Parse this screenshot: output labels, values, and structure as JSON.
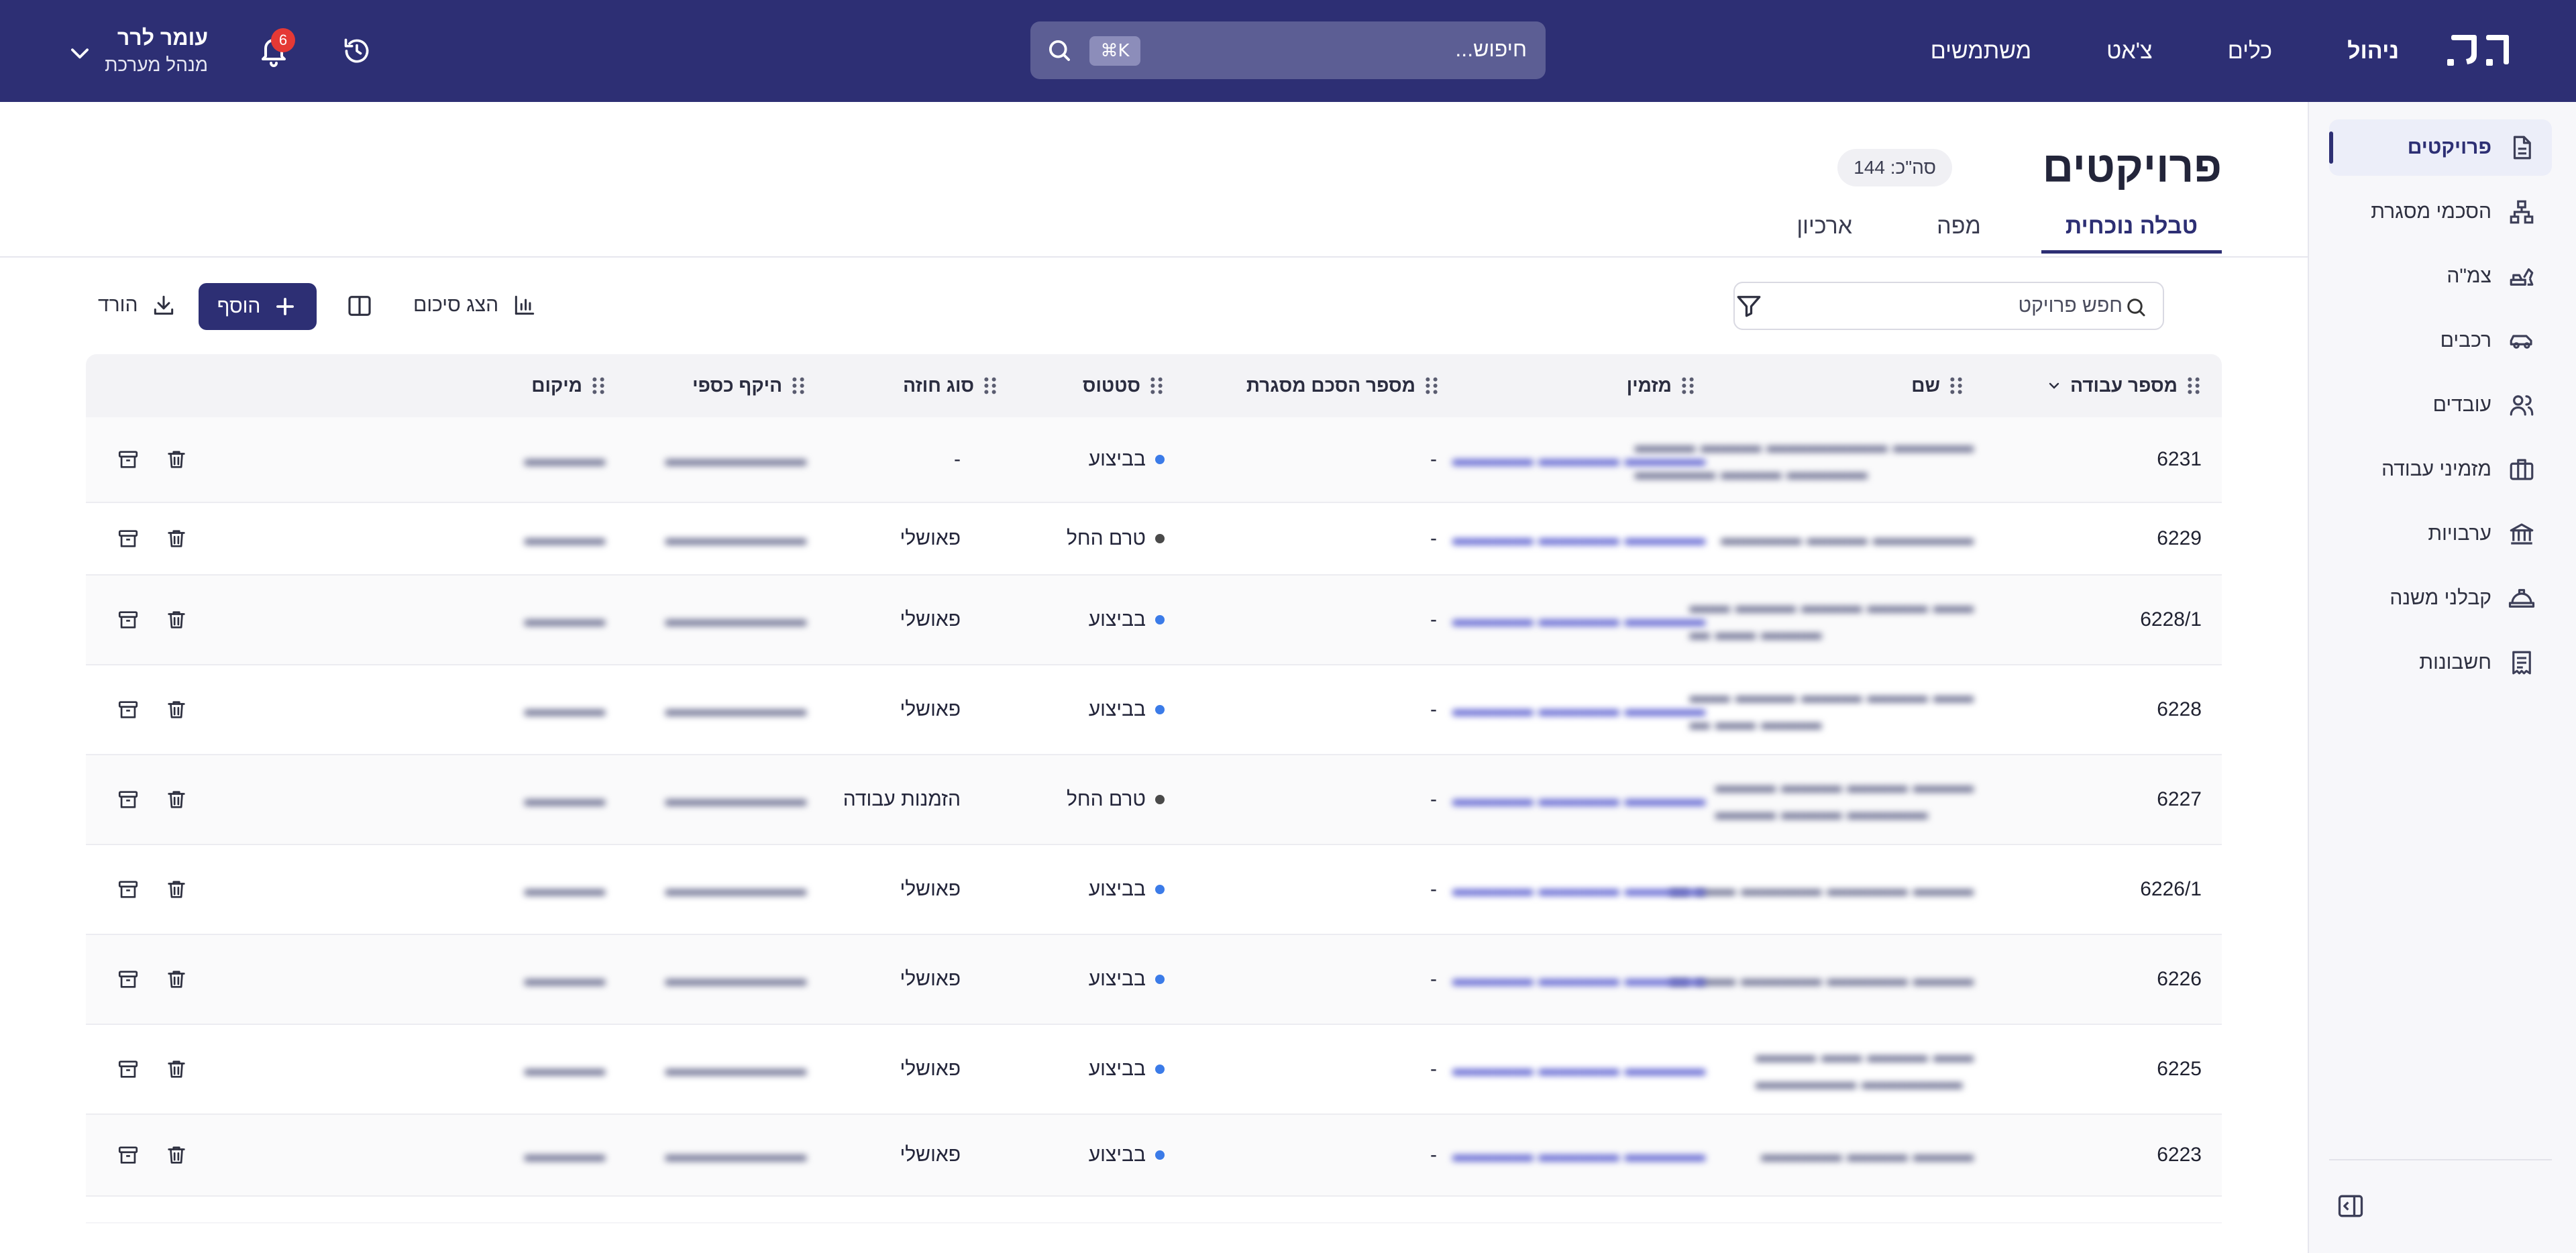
{
  "topbar": {
    "brand": "י.ל.",
    "nav": [
      "ניהול",
      "כלים",
      "צ'אט",
      "משתמשים"
    ],
    "nav_active": "ניהול",
    "search_placeholder": "חיפוש...",
    "search_shortcut": "⌘K",
    "notification_count": "6",
    "user_name": "עומר לרר",
    "user_role": "מנהל מערכת"
  },
  "sidebar": {
    "items": [
      {
        "label": "פרויקטים",
        "icon": "document-icon",
        "active": true
      },
      {
        "label": "הסכמי מסגרת",
        "icon": "hierarchy-icon",
        "active": false
      },
      {
        "label": "צמ\"ה",
        "icon": "excavator-icon",
        "active": false
      },
      {
        "label": "רכבים",
        "icon": "car-icon",
        "active": false
      },
      {
        "label": "עובדים",
        "icon": "users-icon",
        "active": false
      },
      {
        "label": "מזמיני עבודה",
        "icon": "briefcase-icon",
        "active": false
      },
      {
        "label": "ערבויות",
        "icon": "bank-icon",
        "active": false
      },
      {
        "label": "קבלני משנה",
        "icon": "hardhat-icon",
        "active": false
      },
      {
        "label": "חשבונות",
        "icon": "receipt-icon",
        "active": false
      }
    ]
  },
  "page": {
    "title": "פרויקטים",
    "count_label": "סה\"כ: 144",
    "tabs": [
      "טבלה נוכחית",
      "מפה",
      "ארכיון"
    ],
    "active_tab": "טבלה נוכחית",
    "search_placeholder": "חפש פרויקט",
    "toolbar": {
      "summary": "הצג סיכום",
      "add": "הוסף",
      "download": "הורד"
    }
  },
  "table": {
    "columns": [
      "מספר עבודה",
      "שם",
      "מזמין",
      "מספר הסכם מסגרת",
      "סטטוס",
      "סוג חוזה",
      "היקף כספי",
      "מיקום"
    ],
    "sorted_column": "מספר עבודה",
    "rows": [
      {
        "id": "6231",
        "framework": "-",
        "status": "בביצוע",
        "contract": "-"
      },
      {
        "id": "6229",
        "framework": "-",
        "status": "טרם החל",
        "contract": "פאושלי"
      },
      {
        "id": "6228/1",
        "framework": "-",
        "status": "בביצוע",
        "contract": "פאושלי"
      },
      {
        "id": "6228",
        "framework": "-",
        "status": "בביצוע",
        "contract": "פאושלי"
      },
      {
        "id": "6227",
        "framework": "-",
        "status": "טרם החל",
        "contract": "הזמנות עבודה"
      },
      {
        "id": "6226/1",
        "framework": "-",
        "status": "בביצוע",
        "contract": "פאושלי"
      },
      {
        "id": "6226",
        "framework": "-",
        "status": "בביצוע",
        "contract": "פאושלי"
      },
      {
        "id": "6225",
        "framework": "-",
        "status": "בביצוע",
        "contract": "פאושלי"
      },
      {
        "id": "6223",
        "framework": "-",
        "status": "בביצוע",
        "contract": "פאושלי"
      }
    ]
  },
  "colors": {
    "brand": "#2d2f74",
    "status_active": "#3b7be8",
    "status_pending": "#4a4a4a",
    "badge": "#e53935"
  }
}
